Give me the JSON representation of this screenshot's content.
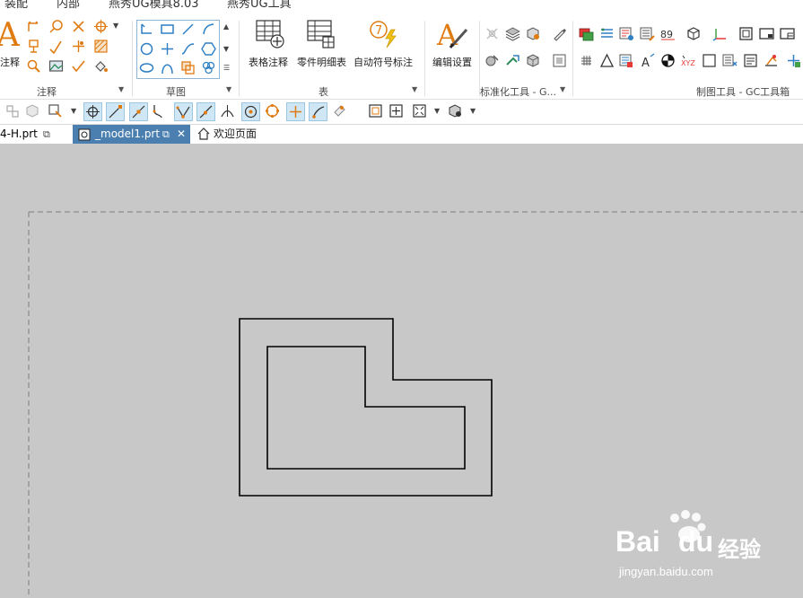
{
  "menubar": {
    "items": [
      "装配",
      "内部",
      "燕秀UG模具8.03",
      "燕秀UG工具"
    ]
  },
  "ribbon": {
    "groups": {
      "annotation": "注释",
      "sketch": "草图",
      "table": "表",
      "std_tools": "标准化工具 - G...",
      "drafting_tools": "制图工具 - GC工具箱"
    },
    "annotation_big_label": "注释",
    "table_buttons": [
      "表格注释",
      "零件明细表",
      "自动符号标注"
    ],
    "edit_settings": "编辑设置"
  },
  "tabs": [
    {
      "label": "4-H.prt"
    },
    {
      "label": "_model1.prt"
    },
    {
      "label": "欢迎页面"
    }
  ],
  "watermark": {
    "brand": "Bai",
    "brand2": "du",
    "cn": "经验",
    "url": "jingyan.baidu.com"
  },
  "colors": {
    "accent_orange": "#e07b12",
    "ribbon_green": "#2e8b57",
    "tab_active": "#4a7fb0",
    "canvas": "#c8c8c8"
  }
}
